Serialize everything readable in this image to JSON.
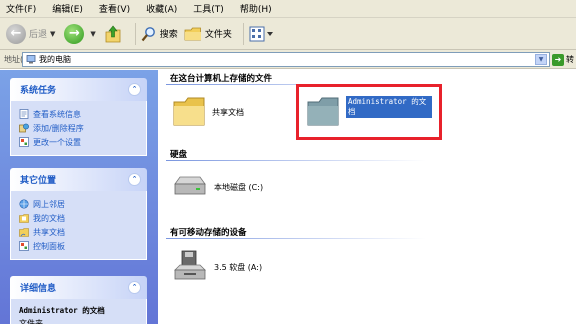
{
  "menu": {
    "items": [
      "文件(F)",
      "编辑(E)",
      "查看(V)",
      "收藏(A)",
      "工具(T)",
      "帮助(H)"
    ]
  },
  "toolbar": {
    "back_label": "后退",
    "search_label": "搜索",
    "folders_label": "文件夹"
  },
  "address": {
    "label": "地址(D)",
    "value": "我的电脑",
    "go_label": "转"
  },
  "sidebar": {
    "system_tasks": {
      "title": "系统任务",
      "items": [
        "查看系统信息",
        "添加/删除程序",
        "更改一个设置"
      ]
    },
    "other_places": {
      "title": "其它位置",
      "items": [
        "网上邻居",
        "我的文档",
        "共享文档",
        "控制面板"
      ]
    },
    "details": {
      "title": "详细信息",
      "name": "Administrator 的文档",
      "type": "文件夹"
    }
  },
  "content": {
    "groups": [
      {
        "title": "在这台计算机上存储的文件",
        "items": [
          "共享文档",
          "Administrator 的文档"
        ]
      },
      {
        "title": "硬盘",
        "items": [
          "本地磁盘 (C:)"
        ]
      },
      {
        "title": "有可移动存储的设备",
        "items": [
          "3.5 软盘 (A:)"
        ]
      }
    ]
  },
  "colors": {
    "accent": "#316ac5",
    "panel_text": "#215dc6",
    "highlight": "#e8212b",
    "toolbar_bg": "#ece9d8",
    "sidebar_bg": "#6f8be0"
  }
}
